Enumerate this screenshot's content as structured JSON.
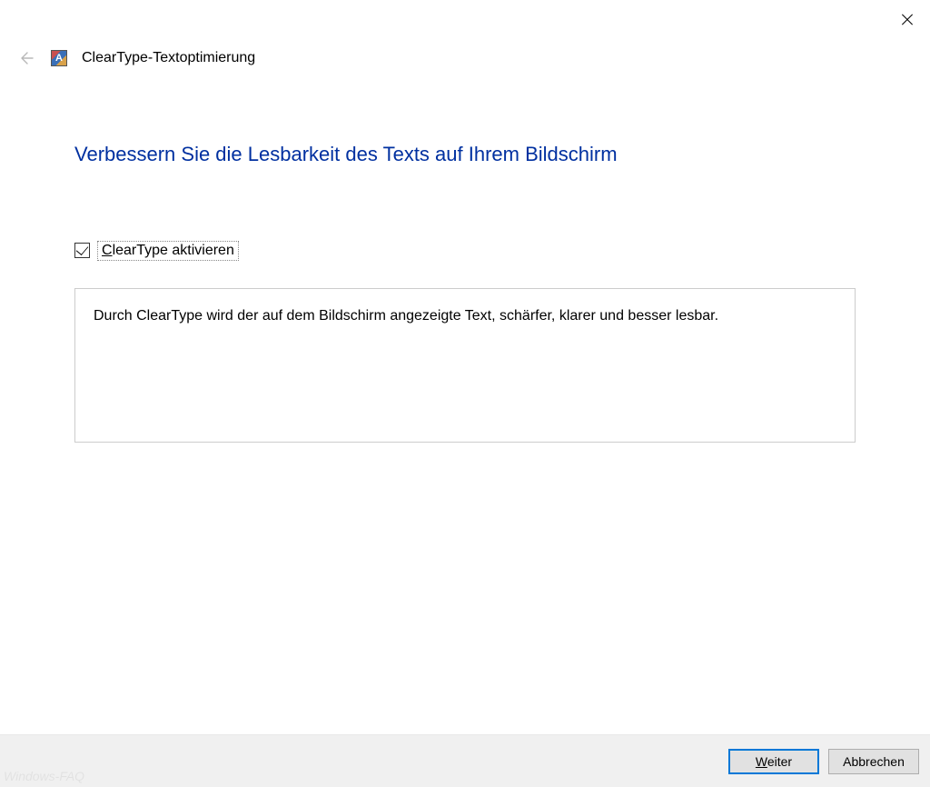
{
  "window": {
    "title": "ClearType-Textoptimierung"
  },
  "main": {
    "heading": "Verbessern Sie die Lesbarkeit des Texts auf Ihrem Bildschirm",
    "checkbox": {
      "checked": true,
      "prefix": "C",
      "rest": "learType aktivieren"
    },
    "info_text": "Durch ClearType wird der auf dem Bildschirm angezeigte Text, schärfer, klarer und besser lesbar."
  },
  "footer": {
    "next_prefix": "W",
    "next_rest": "eiter",
    "cancel": "Abbrechen"
  },
  "watermark": "Windows-FAQ"
}
